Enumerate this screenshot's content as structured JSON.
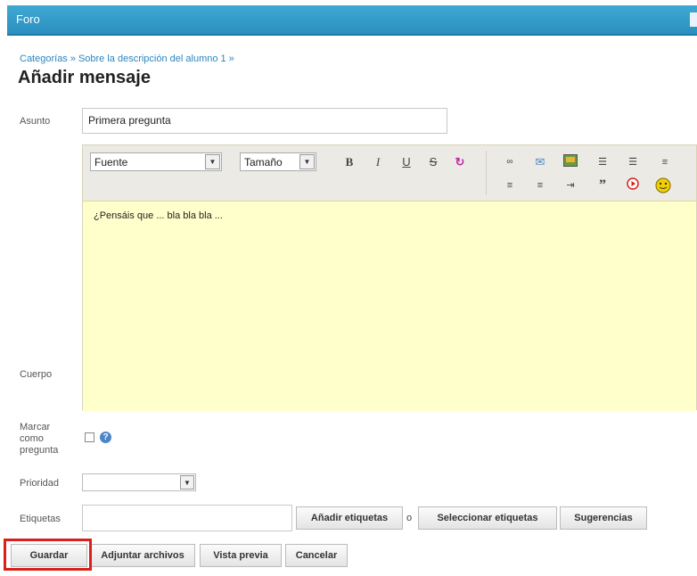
{
  "window": {
    "title": "Foro"
  },
  "breadcrumb": {
    "items": [
      "Categorías",
      "Sobre la descripción del alumno 1"
    ],
    "separator": "»"
  },
  "page_title": "Añadir mensaje",
  "form": {
    "subject_label": "Asunto",
    "subject_value": "Primera pregunta",
    "body_label": "Cuerpo",
    "body_text": "¿Pensáis que ... bla  bla  bla ...",
    "mark_label_lines": [
      "Marcar",
      "como",
      "pregunta"
    ],
    "mark_checked": false,
    "priority_label": "Prioridad",
    "priority_value": "",
    "tags_label": "Etiquetas",
    "tags_value": "",
    "or_text": "o"
  },
  "toolbar": {
    "font_select": "Fuente",
    "size_select": "Tamaño",
    "icons": [
      "bold-icon",
      "italic-icon",
      "underline-icon",
      "strikethrough-icon",
      "text-color-icon",
      "link-icon",
      "email-icon",
      "image-icon",
      "ordered-list-icon",
      "unordered-list-icon",
      "align-left-icon",
      "align-center-icon",
      "align-right-icon",
      "indent-icon",
      "quote-icon",
      "youtube-icon",
      "smiley-icon"
    ]
  },
  "buttons": {
    "add_tags": "Añadir etiquetas",
    "select_tags": "Seleccionar etiquetas",
    "suggestions": "Sugerencias",
    "save": "Guardar",
    "attach": "Adjuntar archivos",
    "preview": "Vista previa",
    "cancel": "Cancelar"
  },
  "colors": {
    "header": "#2b8fbf",
    "link": "#2a87c0",
    "editor_bg": "#ffffcc",
    "highlight": "#d9201c"
  }
}
